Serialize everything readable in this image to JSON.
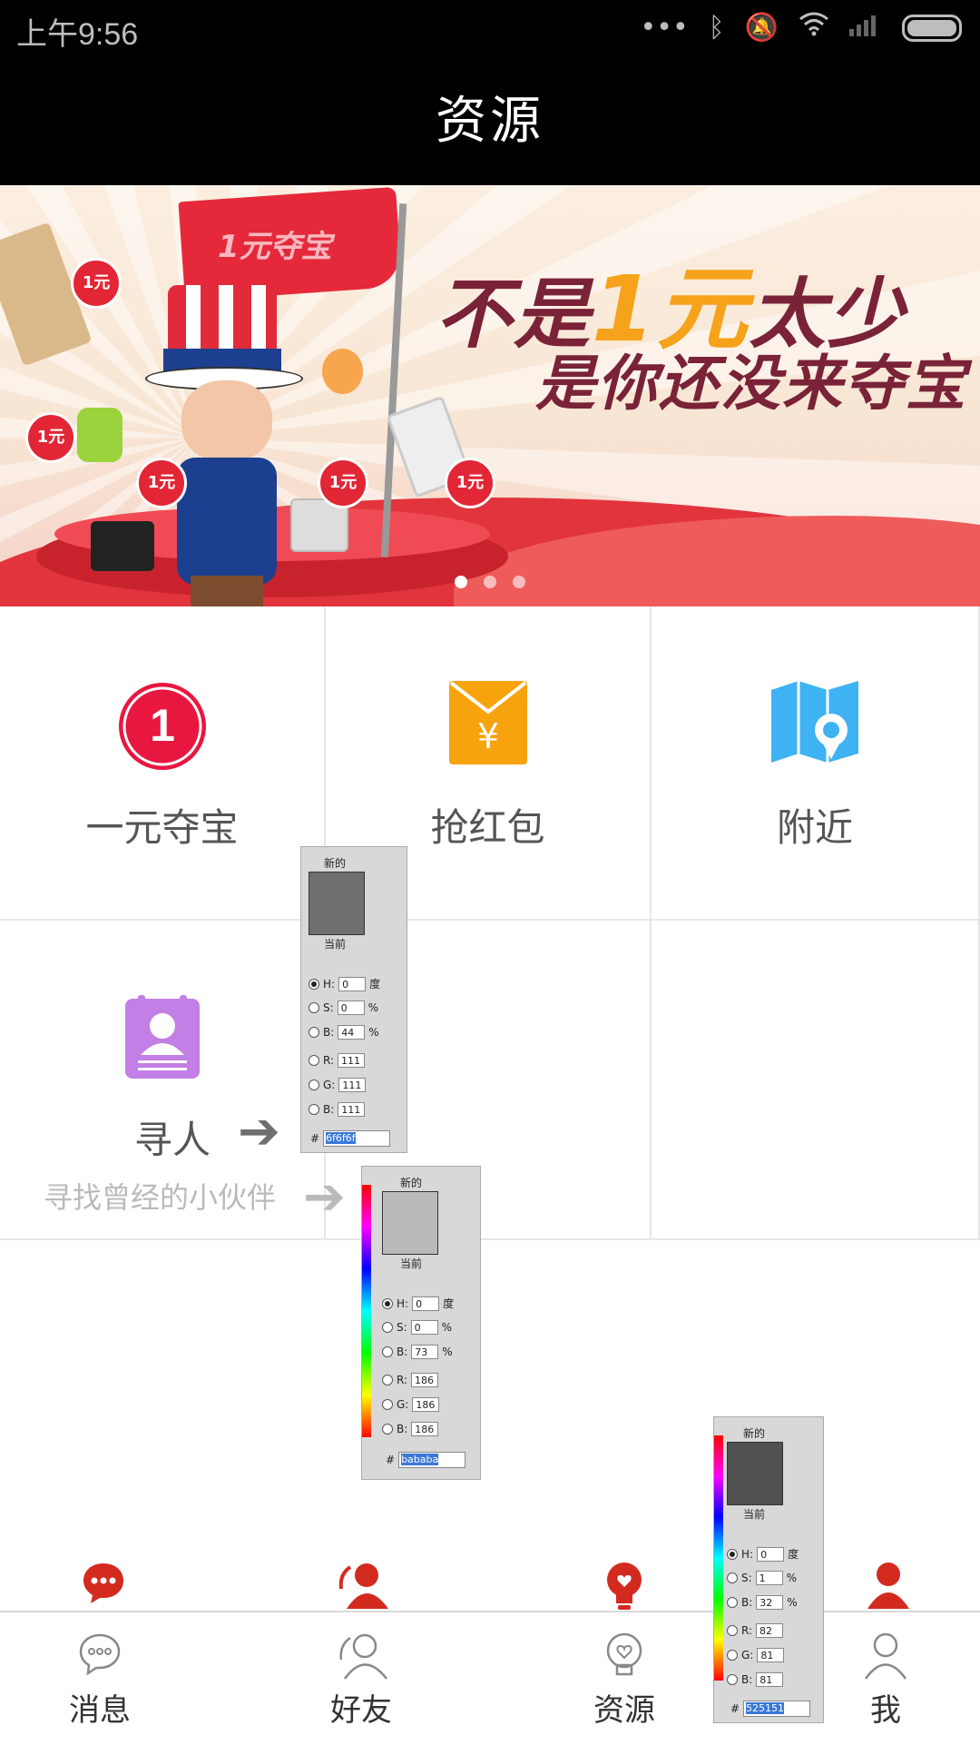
{
  "status_bar": {
    "time": "上午9:56"
  },
  "header": {
    "title": "资源"
  },
  "banner": {
    "flag_text": "1元夺宝",
    "slogan_line1_a": "不是",
    "slogan_line1_hl": "1元",
    "slogan_line1_b": "太少",
    "slogan_line2": "是你还没来夺宝",
    "coin_label": "1元"
  },
  "grid": {
    "items": [
      {
        "label": "一元夺宝",
        "icon": "one-yuan-icon",
        "icon_number": "1",
        "color": "#e8173f"
      },
      {
        "label": "抢红包",
        "icon": "red-envelope-icon",
        "icon_symbol": "¥",
        "color": "#f7a30e"
      },
      {
        "label": "附近",
        "icon": "map-pin-icon",
        "color": "#3fb2f4"
      },
      {
        "label": "寻人",
        "icon": "contact-card-icon",
        "color": "#c27fe5",
        "subtitle": "寻找曾经的小伙伴"
      }
    ]
  },
  "pickers": [
    {
      "new_label": "新的",
      "current_label": "当前",
      "swatch": "#6f6f6f",
      "h": "0",
      "s": "0",
      "b": "44",
      "r": "111",
      "g": "111",
      "bl": "111",
      "hex": "6f6f6f",
      "deg": "度",
      "pct": "%"
    },
    {
      "new_label": "新的",
      "current_label": "当前",
      "swatch": "#bababa",
      "h": "0",
      "s": "0",
      "b": "73",
      "r": "186",
      "g": "186",
      "bl": "186",
      "hex": "bababa",
      "deg": "度",
      "pct": "%"
    },
    {
      "new_label": "新的",
      "current_label": "当前",
      "swatch": "#525151",
      "h": "0",
      "s": "1",
      "b": "32",
      "r": "82",
      "g": "81",
      "bl": "81",
      "hex": "525151",
      "deg": "度",
      "pct": "%"
    }
  ],
  "picker_field_labels": {
    "h": "H:",
    "s": "S:",
    "b": "B:",
    "r": "R:",
    "g": "G:",
    "bl": "B:",
    "hash": "#"
  },
  "tabs": [
    {
      "label": "消息",
      "icon": "message-bubble-icon"
    },
    {
      "label": "好友",
      "icon": "friends-icon"
    },
    {
      "label": "资源",
      "icon": "bulb-icon"
    },
    {
      "label": "我",
      "icon": "person-icon"
    }
  ],
  "colors": {
    "accent_red": "#d32a20",
    "header_bg": "#000000",
    "text_dark": "#6f6f6f",
    "text_light": "#bababa",
    "tab_text": "#525151"
  }
}
